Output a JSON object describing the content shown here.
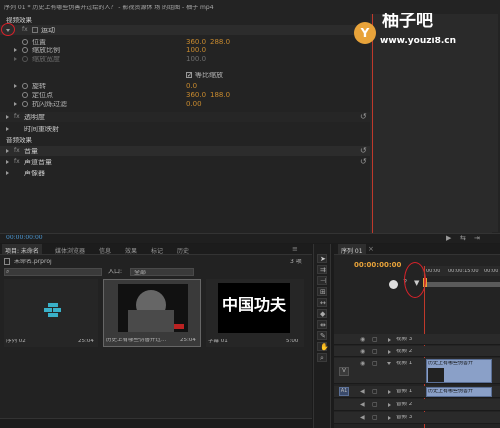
{
  "title_bar": {
    "text": "序列 01 * 历史上有哪些伪善开过绘的人？ - 影视资源休 场 的组图 - 柚子 mp4"
  },
  "logo": {
    "brand": "柚子吧",
    "url": "www.youzi8.cn",
    "badge": "Y"
  },
  "effect_controls": {
    "video_effects_header": "视频效果",
    "motion": "运动",
    "position_label": "位置",
    "position_x": "360.0",
    "position_y": "288.0",
    "scale_label": "缩放比例",
    "scale_value": "100.0",
    "scale_width_label": "缩放宽度",
    "scale_width_value": "100.0",
    "uniform_scale": "等比缩放",
    "rotation_label": "旋转",
    "rotation_value": "0.0",
    "anchor_label": "定位点",
    "anchor_x": "360.0",
    "anchor_y": "188.0",
    "antiflicker_label": "抗闪烁过滤",
    "antiflicker_value": "0.00",
    "opacity": "透明度",
    "time_remap": "时间重映射",
    "audio_effects_header": "音频效果",
    "volume": "音量",
    "channel_volume": "声道音量",
    "panner": "声像器",
    "timecode": "00:00:00:00"
  },
  "project_panel": {
    "tabs": [
      "项目: 未命名",
      "媒体浏览器",
      "信息",
      "效果",
      "标记",
      "历史"
    ],
    "project_name": "未命名.prproj",
    "item_count": "3 项",
    "in_label": "入口:",
    "in_value": "全部",
    "items": [
      {
        "name": "序列 02",
        "duration": "25:04"
      },
      {
        "name": "历史上有哪些伪善开过...",
        "duration": "25:04"
      },
      {
        "name": "字幕 01",
        "duration": "5:00"
      }
    ],
    "title_card_text": "中国功夫"
  },
  "timeline": {
    "tab": "序列 01",
    "timecode": "00:00:00:00",
    "ruler": [
      "00:00",
      "00:00:15:00",
      "00:00"
    ],
    "video_tracks": [
      "视频 3",
      "视频 2",
      "视频 1"
    ],
    "audio_tracks": [
      "音频 1",
      "音频 2",
      "音频 3"
    ],
    "v_label": "V",
    "a_label": "A1",
    "clip_label": "历史上有哪些伪善开",
    "audio_clip_label": "历史上有哪些伪善开"
  }
}
